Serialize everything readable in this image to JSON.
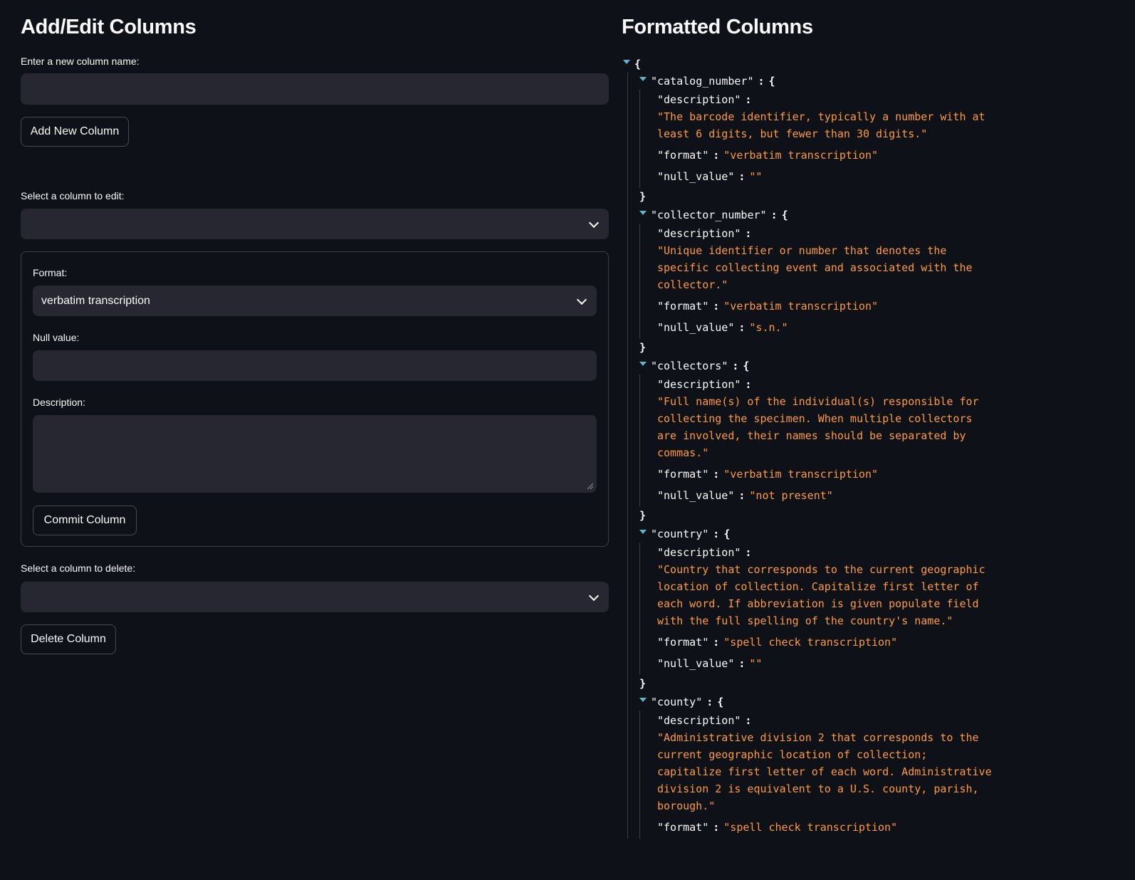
{
  "left": {
    "title": "Add/Edit Columns",
    "new_column_label": "Enter a new column name:",
    "new_column_value": "",
    "add_button": "Add New Column",
    "edit_select_label": "Select a column to edit:",
    "edit_select_value": "",
    "format_label": "Format:",
    "format_value": "verbatim transcription",
    "null_label": "Null value:",
    "null_value": "",
    "description_label": "Description:",
    "description_value": "",
    "commit_button": "Commit Column",
    "delete_select_label": "Select a column to delete:",
    "delete_select_value": "",
    "delete_button": "Delete Column"
  },
  "right": {
    "title": "Formatted Columns",
    "columns": [
      {
        "name": "\"catalog_number\"",
        "description": "\"The barcode identifier, typically a number with at least 6 digits, but fewer than 30 digits.\"",
        "format": "\"verbatim transcription\"",
        "null_value": "\"\""
      },
      {
        "name": "\"collector_number\"",
        "description": "\"Unique identifier or number that denotes the specific collecting event and associated with the collector.\"",
        "format": "\"verbatim transcription\"",
        "null_value": "\"s.n.\""
      },
      {
        "name": "\"collectors\"",
        "description": "\"Full name(s) of the individual(s) responsible for collecting the specimen. When multiple collectors are involved, their names should be separated by commas.\"",
        "format": "\"verbatim transcription\"",
        "null_value": "\"not present\""
      },
      {
        "name": "\"country\"",
        "description": "\"Country that corresponds to the current geographic location of collection. Capitalize first letter of each word. If abbreviation is given populate field with the full spelling of the country's name.\"",
        "format": "\"spell check transcription\"",
        "null_value": "\"\""
      },
      {
        "name": "\"county\"",
        "description": "\"Administrative division 2 that corresponds to the current geographic location of collection; capitalize first letter of each word. Administrative division 2 is equivalent to a U.S. county, parish, borough.\"",
        "format": "\"spell check transcription\"",
        "null_value": ""
      }
    ],
    "keys": {
      "description": "\"description\"",
      "format": "\"format\"",
      "null_value": "\"null_value\""
    },
    "open_brace": "{",
    "close_brace": "}",
    "colon": ":"
  }
}
